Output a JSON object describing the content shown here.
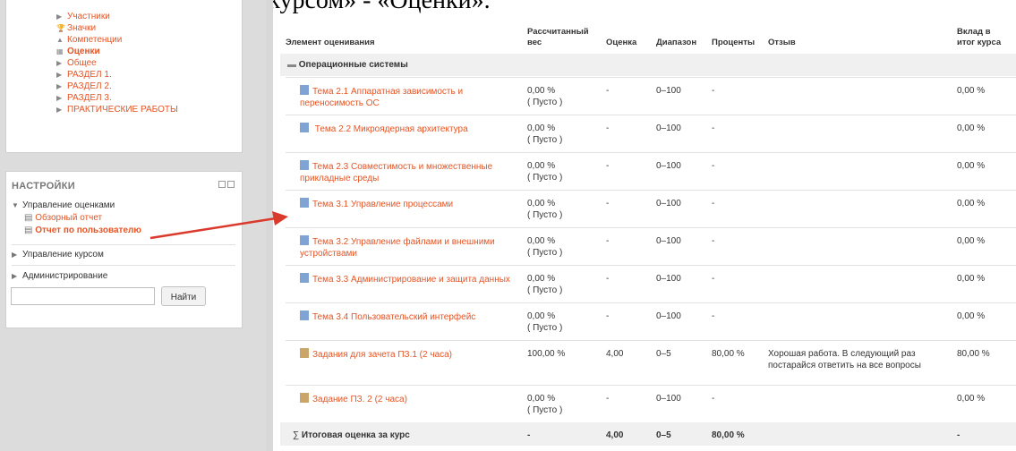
{
  "doc_header": "...на пункт «Управление курсом» - «Оценки».",
  "navigation": {
    "items": [
      {
        "label": "Участники",
        "icon": "caret-right-icon"
      },
      {
        "label": "Значки",
        "icon": "trophy-icon"
      },
      {
        "label": "Компетенции",
        "icon": "competency-icon"
      },
      {
        "label": "Оценки",
        "icon": "table-icon"
      },
      {
        "label": "Общее",
        "icon": "caret-right-icon"
      },
      {
        "label": "РАЗДЕЛ 1.",
        "icon": "caret-right-icon"
      },
      {
        "label": "РАЗДЕЛ 2.",
        "icon": "caret-right-icon"
      },
      {
        "label": "РАЗДЕЛ 3.",
        "icon": "caret-right-icon"
      },
      {
        "label": "ПРАКТИЧЕСКИЕ РАБОТЫ",
        "icon": "caret-right-icon"
      }
    ]
  },
  "settings": {
    "title": "НАСТРОЙКИ",
    "grade_admin": "Управление оценками",
    "overview_report": "Обзорный отчет",
    "user_report": "Отчет по пользователю",
    "course_admin": "Управление курсом",
    "site_admin": "Администрирование",
    "search_button": "Найти",
    "search_value": ""
  },
  "table": {
    "headers": {
      "item": "Элемент оценивания",
      "weight_line1": "Рассчитанный",
      "weight_line2": "вес",
      "grade": "Оценка",
      "range": "Диапазон",
      "percent": "Проценты",
      "feedback": "Отзыв",
      "contrib_line1": "Вклад в",
      "contrib_line2": "итог курса"
    },
    "category": "Операционные системы",
    "rows": [
      {
        "name": "Тема 2.1 Аппаратная зависимость и переносимость ОС",
        "weight": "0,00 %",
        "empty": "( Пусто )",
        "grade": "-",
        "range": "0–100",
        "percent": "-",
        "feedback": "",
        "contrib": "0,00 %"
      },
      {
        "name": " Тема 2.2 Микроядерная архитектура",
        "weight": "0,00 %",
        "empty": "( Пусто )",
        "grade": "-",
        "range": "0–100",
        "percent": "-",
        "feedback": "",
        "contrib": "0,00 %"
      },
      {
        "name": "Тема 2.3 Совместимость и множественные прикладные среды",
        "weight": "0,00 %",
        "empty": "( Пусто )",
        "grade": "-",
        "range": "0–100",
        "percent": "-",
        "feedback": "",
        "contrib": "0,00 %"
      },
      {
        "name": "Тема 3.1 Управление процессами",
        "weight": "0,00 %",
        "empty": "( Пусто )",
        "grade": "-",
        "range": "0–100",
        "percent": "-",
        "feedback": "",
        "contrib": "0,00 %"
      },
      {
        "name": "Тема 3.2 Управление файлами и внешними устройствами",
        "weight": "0,00 %",
        "empty": "( Пусто )",
        "grade": "-",
        "range": "0–100",
        "percent": "-",
        "feedback": "",
        "contrib": "0,00 %"
      },
      {
        "name": "Тема 3.3 Администрирование и защита данных",
        "weight": "0,00 %",
        "empty": "( Пусто )",
        "grade": "-",
        "range": "0–100",
        "percent": "-",
        "feedback": "",
        "contrib": "0,00 %"
      },
      {
        "name": "Тема 3.4 Пользовательский интерфейс",
        "weight": "0,00 %",
        "empty": "( Пусто )",
        "grade": "-",
        "range": "0–100",
        "percent": "-",
        "feedback": "",
        "contrib": "0,00 %"
      },
      {
        "name": "Задания для зачета ПЗ.1 (2 часа)",
        "weight": "100,00 %",
        "empty": "",
        "grade": "4,00",
        "range": "0–5",
        "percent": "80,00 %",
        "feedback": "Хорошая работа. В следующий раз постарайся ответить на все вопросы",
        "contrib": "80,00 %"
      },
      {
        "name": "Задание ПЗ. 2 (2 часа)",
        "weight": "0,00 %",
        "empty": "( Пусто )",
        "grade": "-",
        "range": "0–100",
        "percent": "-",
        "feedback": "",
        "contrib": "0,00 %"
      }
    ],
    "total": {
      "label": "Итоговая оценка за курс",
      "weight": "-",
      "grade": "4,00",
      "range": "0–5",
      "percent": "80,00 %",
      "contrib": "-"
    }
  },
  "colors": {
    "accent": "#e65424",
    "arrow": "#d93a2b"
  }
}
